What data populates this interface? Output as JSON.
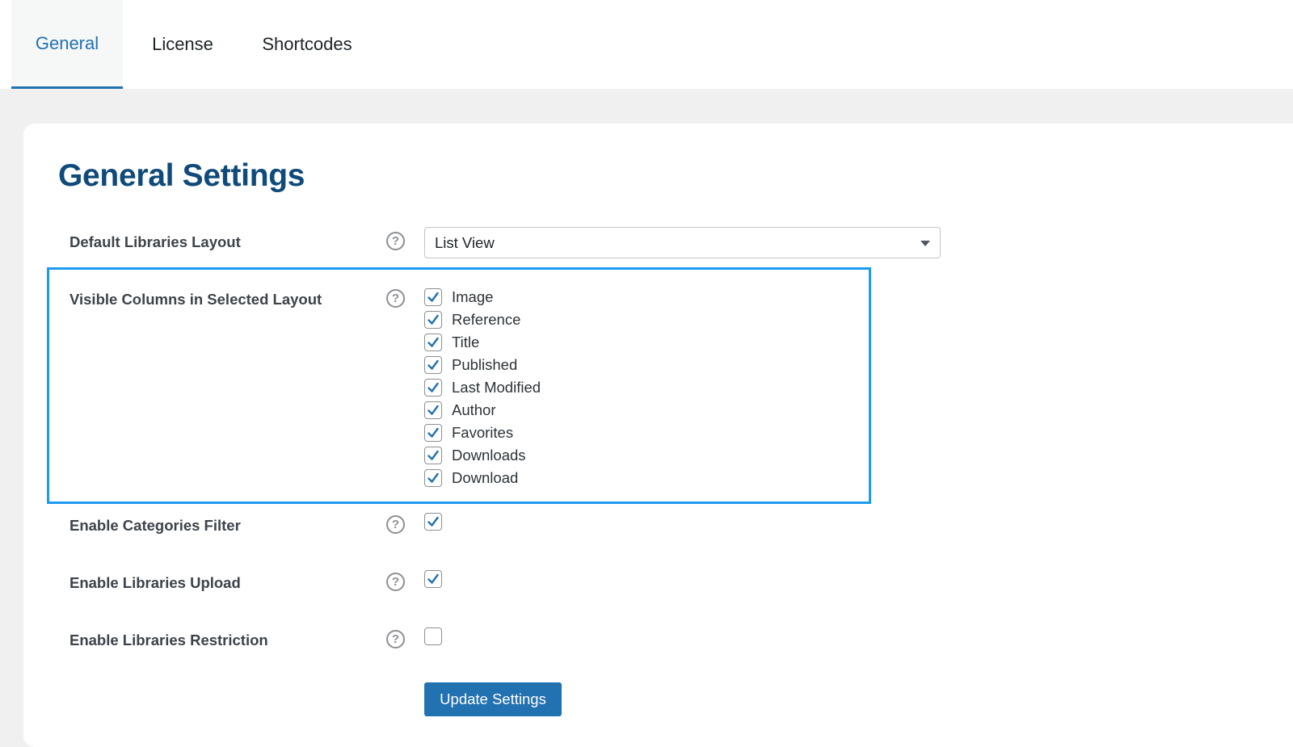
{
  "tabs": [
    {
      "label": "General",
      "active": true
    },
    {
      "label": "License",
      "active": false
    },
    {
      "label": "Shortcodes",
      "active": false
    }
  ],
  "page_title": "General Settings",
  "settings": {
    "default_layout": {
      "label": "Default Libraries Layout",
      "value": "List View"
    },
    "visible_columns": {
      "label": "Visible Columns in Selected Layout",
      "options": [
        {
          "label": "Image",
          "checked": true
        },
        {
          "label": "Reference",
          "checked": true
        },
        {
          "label": "Title",
          "checked": true
        },
        {
          "label": "Published",
          "checked": true
        },
        {
          "label": "Last Modified",
          "checked": true
        },
        {
          "label": "Author",
          "checked": true
        },
        {
          "label": "Favorites",
          "checked": true
        },
        {
          "label": "Downloads",
          "checked": true
        },
        {
          "label": "Download",
          "checked": true
        }
      ]
    },
    "categories_filter": {
      "label": "Enable Categories Filter",
      "checked": true
    },
    "libraries_upload": {
      "label": "Enable Libraries Upload",
      "checked": true
    },
    "libraries_restriction": {
      "label": "Enable Libraries Restriction",
      "checked": false
    }
  },
  "help_glyph": "?",
  "submit_label": "Update Settings",
  "colors": {
    "accent": "#2271b1",
    "title": "#0f4a7a",
    "highlight": "#1d9bf0",
    "background": "#f0f0f1"
  }
}
